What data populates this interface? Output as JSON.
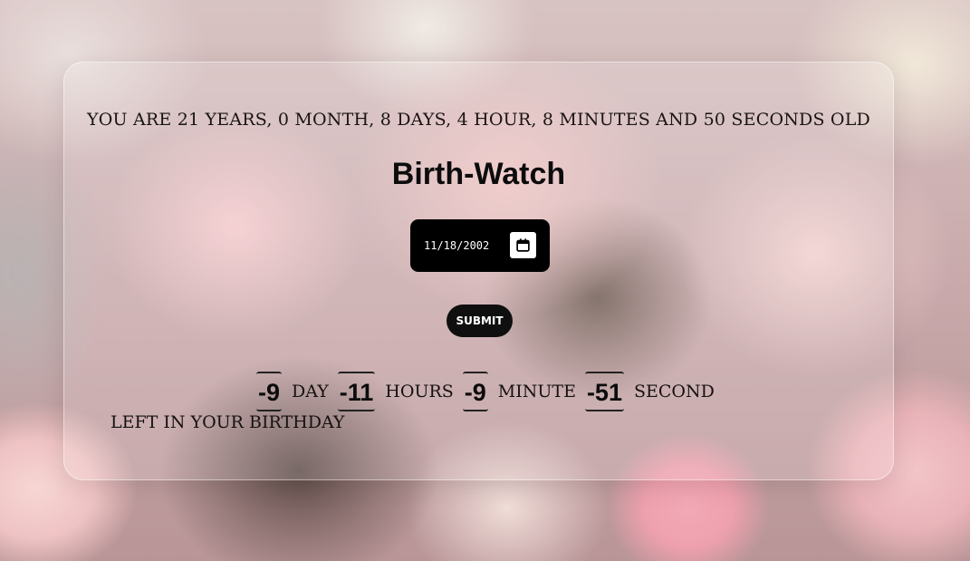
{
  "age": {
    "text": "YOU ARE 21 YEARS, 0 MONTH, 8 DAYS, 4 HOUR, 8 MINUTES AND 50 SECONDS OLD"
  },
  "app": {
    "title": "Birth-Watch"
  },
  "birthdate": {
    "value": "11/18/2002",
    "icon": "calendar-icon"
  },
  "submit": {
    "label": "SUBMIT"
  },
  "countdown": {
    "days": "-9",
    "day_label": "DAY",
    "hours": "-11",
    "hours_label": "HOURS",
    "minutes": "-9",
    "minute_label": "MINUTE",
    "seconds": "-51",
    "second_label": "SECOND",
    "suffix": "LEFT IN YOUR BIRTHDAY"
  },
  "colors": {
    "button_bg": "#0f0f0f",
    "text": "#120f0f",
    "card_border": "#ffffff"
  }
}
